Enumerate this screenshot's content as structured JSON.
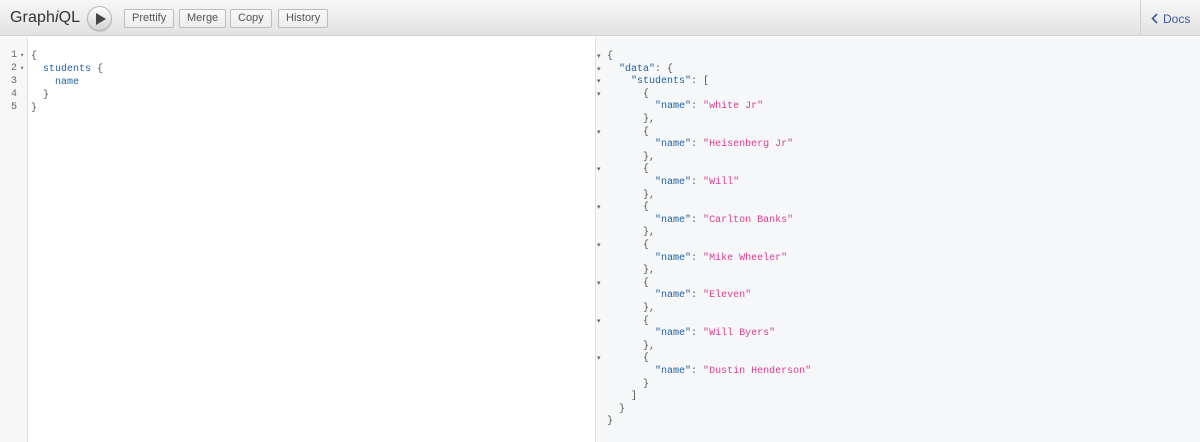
{
  "app": {
    "title_prefix": "Graph",
    "title_italic": "i",
    "title_suffix": "QL"
  },
  "toolbar": {
    "execute_icon": "play-icon",
    "buttons": [
      "Prettify",
      "Merge",
      "Copy",
      "History"
    ]
  },
  "docs": {
    "label": "Docs",
    "icon": "chevron-left-icon"
  },
  "query_editor": {
    "lines": [
      {
        "num": "1",
        "fold": true,
        "indent": "",
        "keyword": "",
        "trail": "{"
      },
      {
        "num": "2",
        "fold": true,
        "indent": "  ",
        "keyword": "students",
        "trail": " {"
      },
      {
        "num": "3",
        "fold": false,
        "indent": "    ",
        "keyword": "name",
        "trail": ""
      },
      {
        "num": "4",
        "fold": false,
        "indent": "  ",
        "keyword": "",
        "trail": "}"
      },
      {
        "num": "5",
        "fold": false,
        "indent": "",
        "keyword": "",
        "trail": "}"
      }
    ]
  },
  "result": {
    "names": [
      "white Jr",
      "Heisenberg Jr",
      "Will",
      "Carlton Banks",
      "Mike Wheeler",
      "Eleven",
      "Will Byers",
      "Dustin Henderson"
    ]
  },
  "colors": {
    "key": "#1f61a0",
    "string": "#d64292",
    "result_bg": "#f6f7f8",
    "toolbar_bg": "#e9e9e9"
  }
}
